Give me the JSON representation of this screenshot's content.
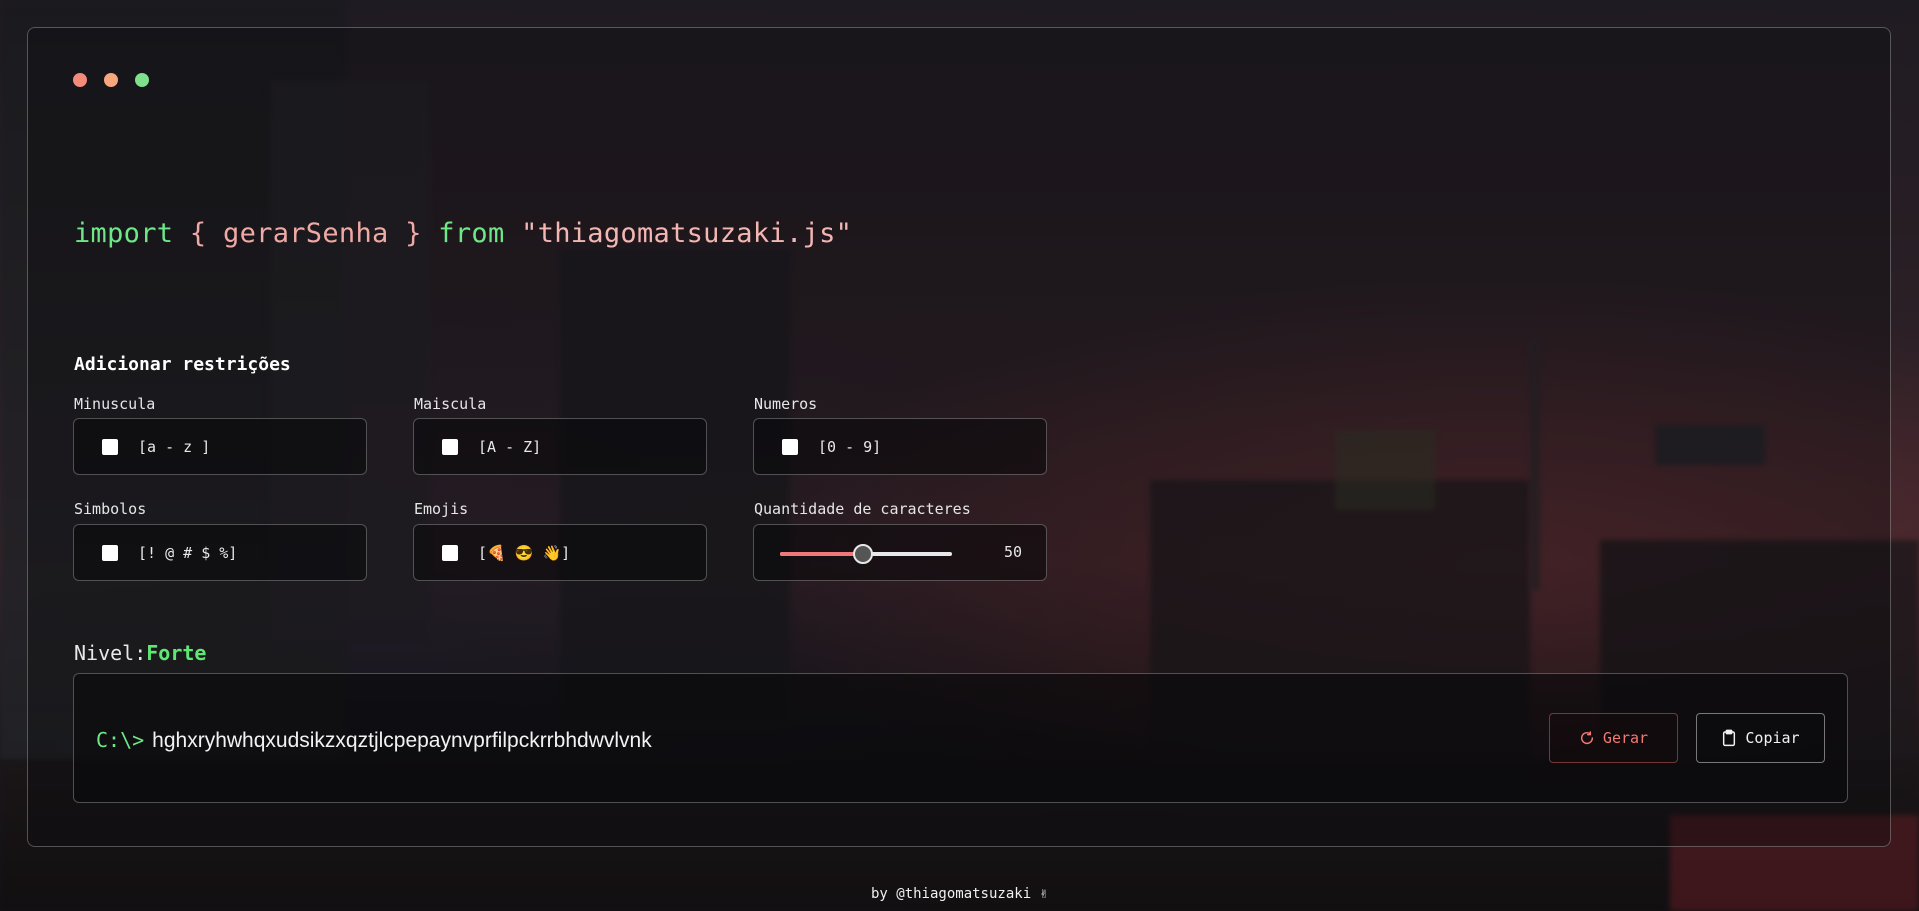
{
  "window_dots": [
    "#f48a7a",
    "#f8a67c",
    "#7ee08b"
  ],
  "code": {
    "keyword_import": "import",
    "brace_open": "{",
    "function_name": "gerarSenha",
    "brace_close": "}",
    "keyword_from": "from",
    "module": "\"thiagomatsuzaki.js\""
  },
  "restrictions": {
    "title": "Adicionar restrições",
    "lowercase": {
      "label": "Minuscula",
      "range": "[a - z ]",
      "checked": false
    },
    "uppercase": {
      "label": "Maiscula",
      "range": "[A - Z]",
      "checked": false
    },
    "numbers": {
      "label": "Numeros",
      "range": "[0 - 9]",
      "checked": false
    },
    "symbols": {
      "label": "Simbolos",
      "range": "[! @ # $ %]",
      "checked": false
    },
    "emojis": {
      "label": "Emojis",
      "range": "[🍕 😎 👋]",
      "checked": false
    },
    "length": {
      "label": "Quantidade de caracteres",
      "value": "50",
      "fill_fraction": 0.48
    }
  },
  "level": {
    "label": "Nivel:",
    "value": "Forte"
  },
  "output": {
    "prompt": "C:\\>",
    "password": "hghxryhwhqxudsikzxqztjlcpepaynvprfilpckrrbhdwvlvnk"
  },
  "buttons": {
    "generate": "Gerar",
    "copy": "Copiar"
  },
  "colors": {
    "accent_green": "#6ee787",
    "accent_red": "#f27a74",
    "code_pink": "#f0a9a5"
  },
  "footer": "by @thiagomatsuzaki ✌"
}
